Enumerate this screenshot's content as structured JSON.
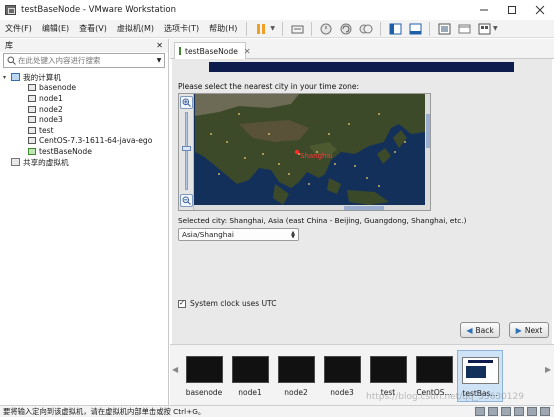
{
  "window": {
    "title": "testBaseNode - VMware Workstation"
  },
  "menu": {
    "items": [
      "文件(F)",
      "编辑(E)",
      "查看(V)",
      "虚拟机(M)",
      "选项卡(T)",
      "帮助(H)"
    ]
  },
  "toolbar": {
    "buttons": [
      "pause-icon",
      "send-keys-icon",
      "snapshot-icon",
      "revert-snapshot-icon",
      "snapshot-manager-icon",
      "library-view-icon",
      "thumbnail-view-icon",
      "fullscreen-icon",
      "unity-icon",
      "console-view-icon"
    ]
  },
  "library": {
    "title": "库",
    "search_placeholder": "在此处键入内容进行搜索",
    "tree": {
      "root_label": "我的计算机",
      "vms": [
        "basenode",
        "node1",
        "node2",
        "node3",
        "test",
        "CentOS-7.3-1611-64-java-ego",
        "testBaseNode"
      ],
      "shared_label": "共享的虚拟机"
    }
  },
  "tab": {
    "label": "testBaseNode"
  },
  "installer": {
    "prompt": "Please select the nearest city in your time zone:",
    "map_city_label": "Shanghai",
    "selected_city": "Selected city: Shanghai, Asia (east China - Beijing, Guangdong, Shanghai, etc.)",
    "timezone_value": "Asia/Shanghai",
    "utc_label": "System clock uses UTC",
    "utc_checked": true,
    "back_label": "Back",
    "next_label": "Next"
  },
  "thumbnails": [
    "basenode",
    "node1",
    "node2",
    "node3",
    "test",
    "CentOS...",
    "testBas..."
  ],
  "status": {
    "text": "要将输入定向到该虚拟机，请在虚拟机内部单击或按 Ctrl+G。"
  },
  "watermark": "https://blog.csdn.net/qq_35630129"
}
